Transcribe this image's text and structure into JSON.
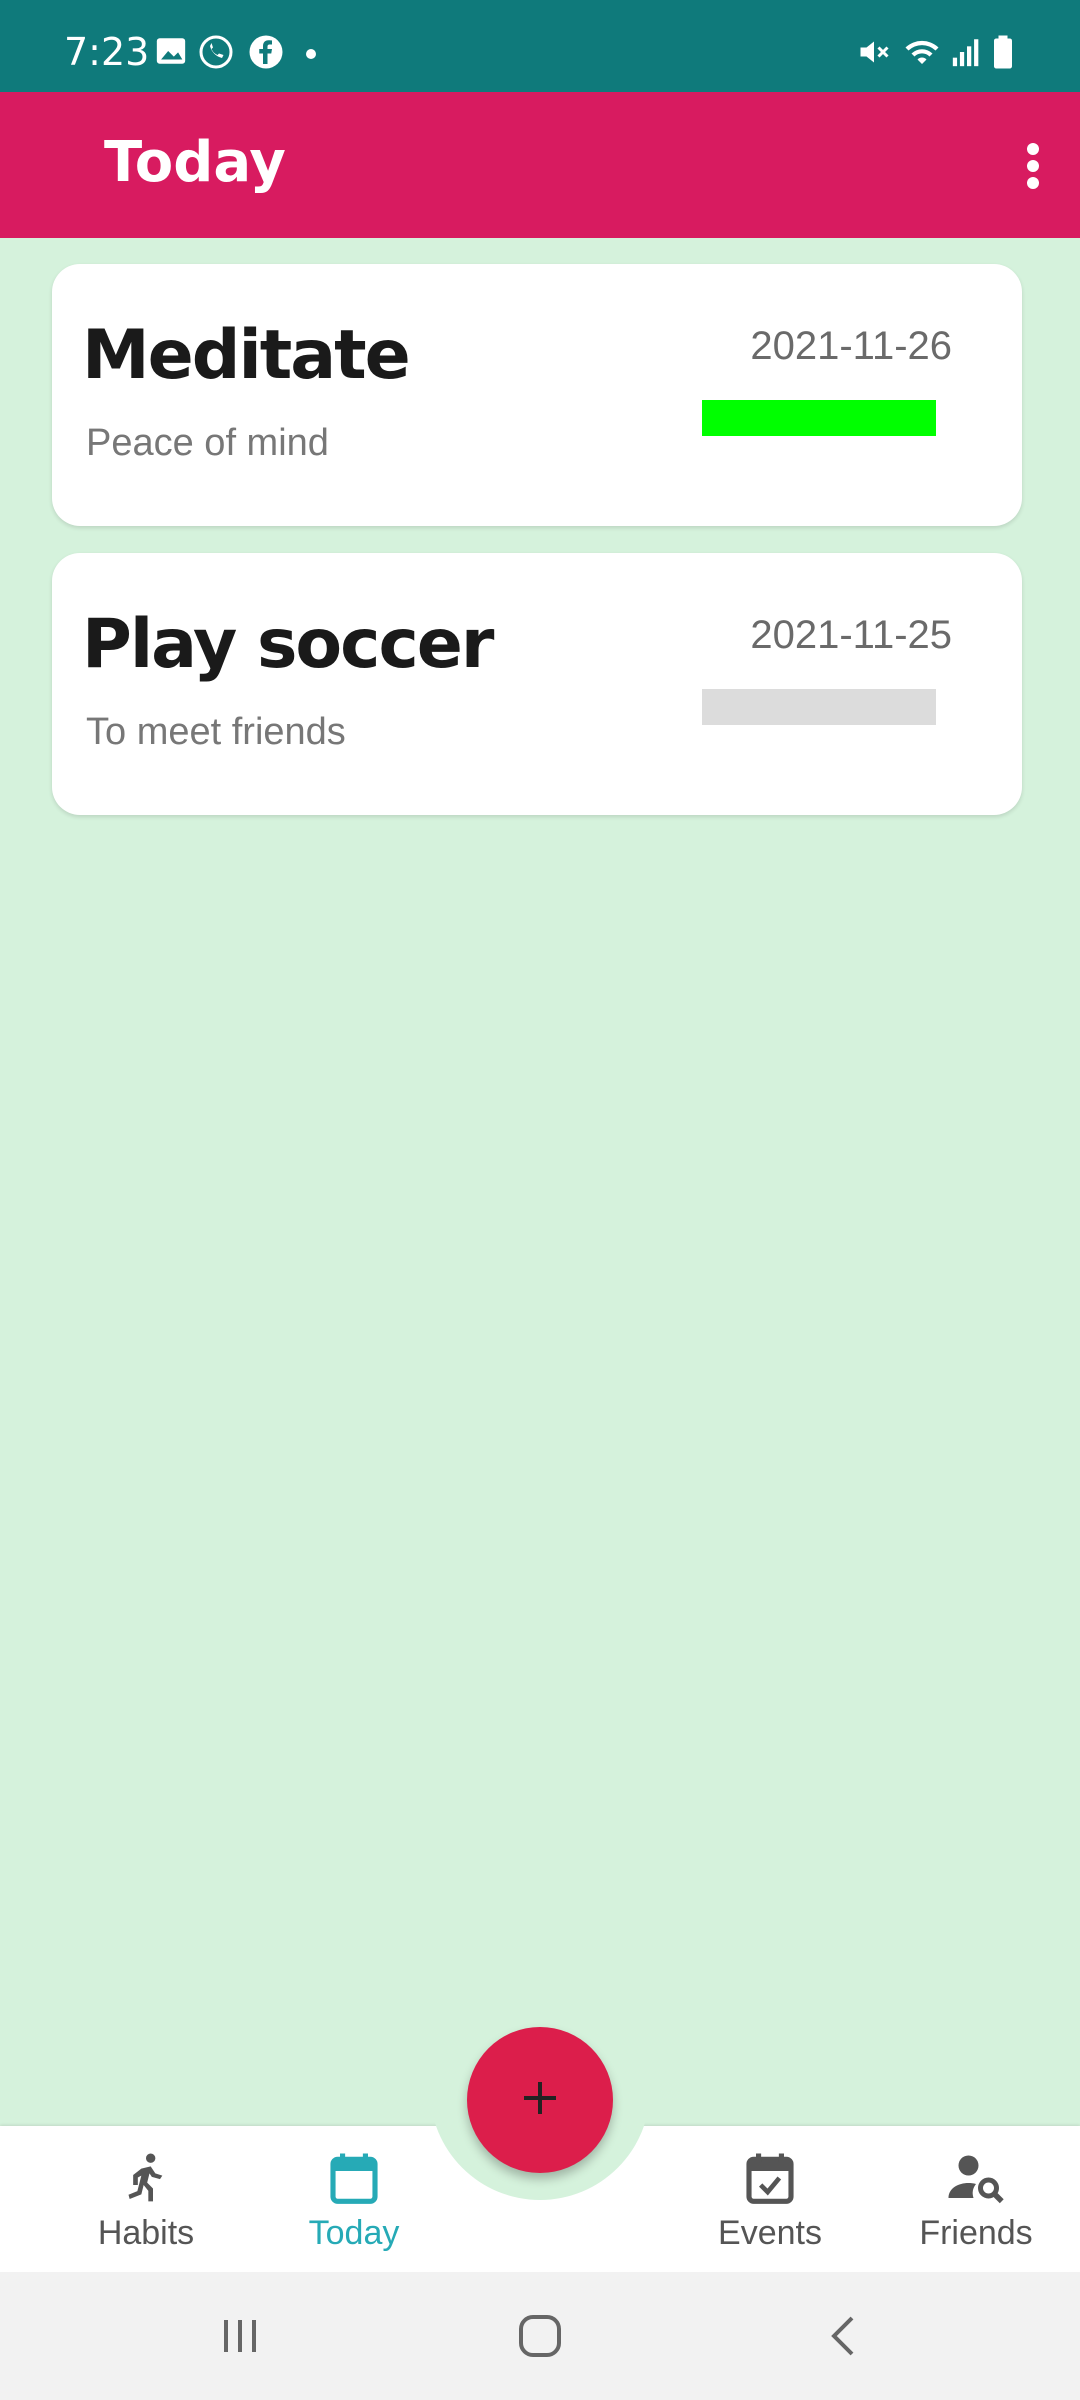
{
  "status_bar": {
    "time": "7:23",
    "icons": [
      "gallery-icon",
      "whatsapp-icon",
      "facebook-icon",
      "dot-icon",
      "mute-icon",
      "wifi-icon",
      "signal-icon",
      "battery-icon"
    ]
  },
  "app_bar": {
    "title": "Today",
    "menu_icon": "more-vert-icon"
  },
  "habits": [
    {
      "title": "Meditate",
      "subtitle": "Peace of mind",
      "date": "2021-11-26",
      "progress": 1.0,
      "progress_color": "#00ff00"
    },
    {
      "title": "Play soccer",
      "subtitle": "To meet friends",
      "date": "2021-11-25",
      "progress": 0.0,
      "progress_color": "#dcdcdc"
    }
  ],
  "bottom_nav": {
    "items": [
      {
        "label": "Habits",
        "icon": "run-icon",
        "active": false
      },
      {
        "label": "Today",
        "icon": "calendar-icon",
        "active": true
      },
      {
        "label": "Events",
        "icon": "event-check-icon",
        "active": false
      },
      {
        "label": "Friends",
        "icon": "person-search-icon",
        "active": false
      }
    ],
    "fab_icon": "plus-icon"
  },
  "colors": {
    "status_bar": "#0f7a7b",
    "app_bar": "#d81b60",
    "background": "#d5f2dc",
    "fab": "#dc1e4b",
    "active_nav": "#26aab6"
  },
  "system_nav": {
    "buttons": [
      "recents-icon",
      "home-icon",
      "back-icon"
    ]
  }
}
